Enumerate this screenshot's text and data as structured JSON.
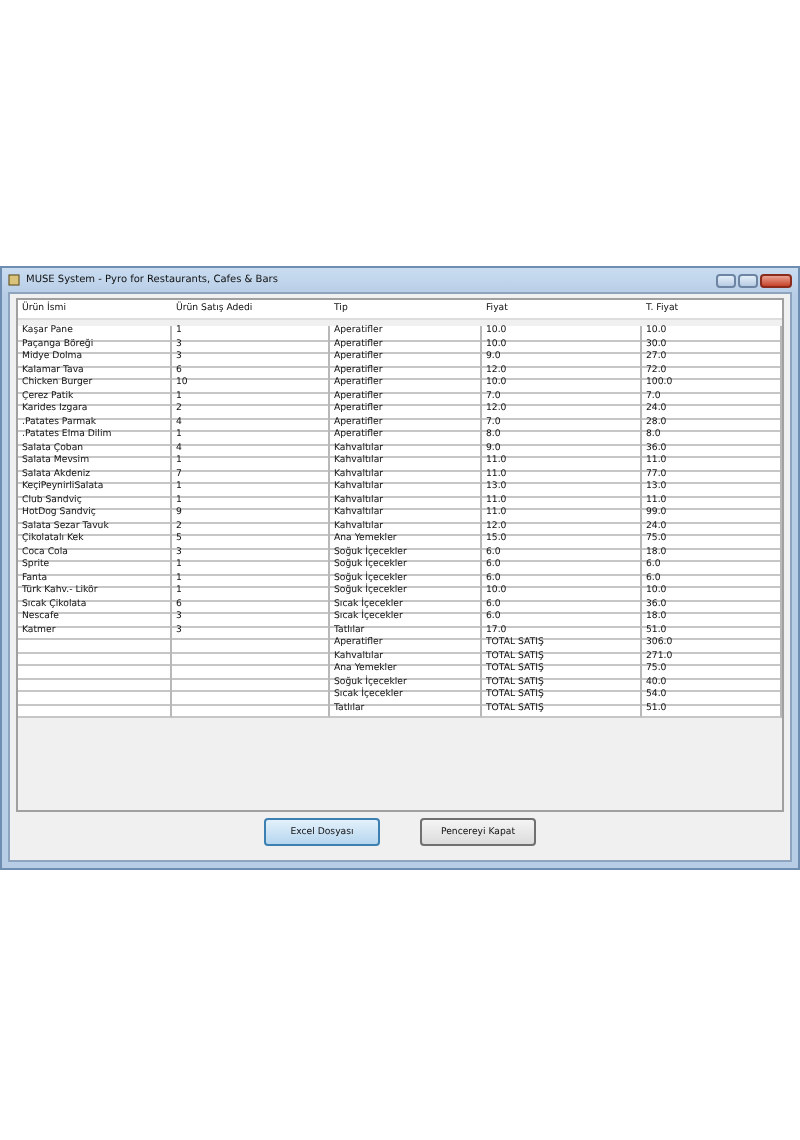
{
  "window": {
    "title": "MUSE System - Pyro for Restaurants, Cafes & Bars"
  },
  "table": {
    "columns": [
      "Ürün İsmi",
      "Ürün Satış Adedi",
      "Tip",
      "Fiyat",
      "T. Fiyat"
    ],
    "rows": [
      {
        "kind": "item",
        "name": "Kaşar Pane",
        "qty": "1",
        "type": "Aperatifler",
        "price": "10.0",
        "total": "10.0"
      },
      {
        "kind": "item",
        "name": "Paçanga Böreği",
        "qty": "3",
        "type": "Aperatifler",
        "price": "10.0",
        "total": "30.0"
      },
      {
        "kind": "item",
        "name": "Midye Dolma",
        "qty": "3",
        "type": "Aperatifler",
        "price": "9.0",
        "total": "27.0"
      },
      {
        "kind": "item",
        "name": "Kalamar Tava",
        "qty": "6",
        "type": "Aperatifler",
        "price": "12.0",
        "total": "72.0"
      },
      {
        "kind": "item",
        "name": "Chicken Burger",
        "qty": "10",
        "type": "Aperatifler",
        "price": "10.0",
        "total": "100.0"
      },
      {
        "kind": "item",
        "name": "Çerez Patik",
        "qty": "1",
        "type": "Aperatifler",
        "price": "7.0",
        "total": "7.0"
      },
      {
        "kind": "item",
        "name": "Karides Izgara",
        "qty": "2",
        "type": "Aperatifler",
        "price": "12.0",
        "total": "24.0"
      },
      {
        "kind": "item",
        "name": ".Patates Parmak",
        "qty": "4",
        "type": "Aperatifler",
        "price": "7.0",
        "total": "28.0"
      },
      {
        "kind": "item",
        "name": ".Patates Elma Dilim",
        "qty": "1",
        "type": "Aperatifler",
        "price": "8.0",
        "total": "8.0"
      },
      {
        "kind": "item",
        "name": "Salata Çoban",
        "qty": "4",
        "type": "Kahvaltılar",
        "price": "9.0",
        "total": "36.0"
      },
      {
        "kind": "item",
        "name": "Salata Mevsim",
        "qty": "1",
        "type": "Kahvaltılar",
        "price": "11.0",
        "total": "11.0"
      },
      {
        "kind": "item",
        "name": "Salata Akdeniz",
        "qty": "7",
        "type": "Kahvaltılar",
        "price": "11.0",
        "total": "77.0"
      },
      {
        "kind": "item",
        "name": "KeçiPeynirliSalata",
        "qty": "1",
        "type": "Kahvaltılar",
        "price": "13.0",
        "total": "13.0"
      },
      {
        "kind": "item",
        "name": "Club Sandviç",
        "qty": "1",
        "type": "Kahvaltılar",
        "price": "11.0",
        "total": "11.0"
      },
      {
        "kind": "item",
        "name": "HotDog Sandviç",
        "qty": "9",
        "type": "Kahvaltılar",
        "price": "11.0",
        "total": "99.0"
      },
      {
        "kind": "item",
        "name": "Salata Sezar Tavuk",
        "qty": "2",
        "type": "Kahvaltılar",
        "price": "12.0",
        "total": "24.0"
      },
      {
        "kind": "item",
        "name": "Çikolatalı Kek",
        "qty": "5",
        "type": "Ana Yemekler",
        "price": "15.0",
        "total": "75.0"
      },
      {
        "kind": "item",
        "name": "Coca Cola",
        "qty": "3",
        "type": "Soğuk İçecekler",
        "price": "6.0",
        "total": "18.0"
      },
      {
        "kind": "item",
        "name": "Sprite",
        "qty": "1",
        "type": "Soğuk İçecekler",
        "price": "6.0",
        "total": "6.0"
      },
      {
        "kind": "item",
        "name": "Fanta",
        "qty": "1",
        "type": "Soğuk İçecekler",
        "price": "6.0",
        "total": "6.0"
      },
      {
        "kind": "item",
        "name": "Türk Kahv.- Likör",
        "qty": "1",
        "type": "Soğuk İçecekler",
        "price": "10.0",
        "total": "10.0"
      },
      {
        "kind": "item",
        "name": "Sıcak Çikolata",
        "qty": "6",
        "type": "Sıcak İçecekler",
        "price": "6.0",
        "total": "36.0"
      },
      {
        "kind": "item",
        "name": "Nescafe",
        "qty": "3",
        "type": "Sıcak İçecekler",
        "price": "6.0",
        "total": "18.0"
      },
      {
        "kind": "item",
        "name": "Katmer",
        "qty": "3",
        "type": "Tatlılar",
        "price": "17.0",
        "total": "51.0"
      },
      {
        "kind": "total",
        "type": "Aperatifler",
        "label": "TOTAL SATIŞ",
        "total": "306.0"
      },
      {
        "kind": "total",
        "type": "Kahvaltılar",
        "label": "TOTAL SATIŞ",
        "total": "271.0"
      },
      {
        "kind": "total",
        "type": "Ana Yemekler",
        "label": "TOTAL SATIŞ",
        "total": "75.0"
      },
      {
        "kind": "total",
        "type": "Soğuk İçecekler",
        "label": "TOTAL SATIŞ",
        "total": "40.0"
      },
      {
        "kind": "total",
        "type": "Sıcak İçecekler",
        "label": "TOTAL SATIŞ",
        "total": "54.0"
      },
      {
        "kind": "total",
        "type": "Tatlılar",
        "label": "TOTAL SATIŞ",
        "total": "51.0"
      }
    ]
  },
  "buttons": [
    {
      "label": "Excel Dosyası",
      "focused": true
    },
    {
      "label": "Pencereyi Kapat",
      "focused": false
    }
  ]
}
